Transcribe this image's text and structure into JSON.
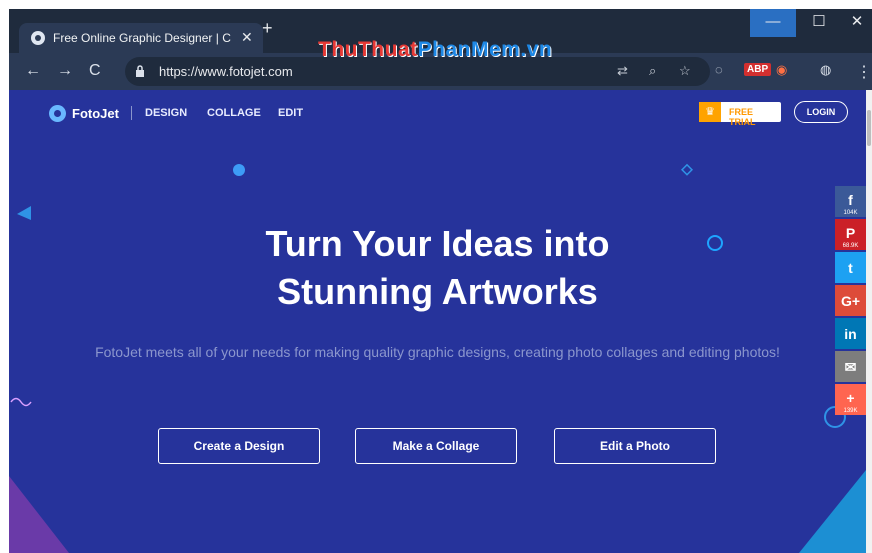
{
  "browser": {
    "tab_title": "Free Online Graphic Designer | C",
    "tab_close": "✕",
    "new_tab": "+",
    "window_controls": {
      "minimize": "—",
      "maximize": "☐",
      "close": "✕"
    },
    "url": "https://www.fotojet.com",
    "watermark": {
      "part1": "ThuThuat",
      "part2": "PhanMem.vn"
    },
    "extensions": {
      "abp": "ABP"
    }
  },
  "site": {
    "brand": "FotoJet",
    "nav": [
      "DESIGN",
      "COLLAGE",
      "EDIT"
    ],
    "free_trial": "FREE TRIAL",
    "login": "LOGIN"
  },
  "hero": {
    "title_line1": "Turn Your Ideas into",
    "title_line2": "Stunning Artworks",
    "subtitle": "FotoJet meets all of your needs for making quality graphic designs, creating photo collages and editing photos!",
    "buttons": [
      "Create a Design",
      "Make a Collage",
      "Edit a Photo"
    ]
  },
  "share": [
    {
      "name": "facebook",
      "glyph": "f",
      "count": "104K",
      "color": "#3b5998"
    },
    {
      "name": "pinterest",
      "glyph": "P",
      "count": "68.9K",
      "color": "#cb2027"
    },
    {
      "name": "twitter",
      "glyph": "t",
      "count": "",
      "color": "#1da1f2"
    },
    {
      "name": "google-plus",
      "glyph": "G+",
      "count": "",
      "color": "#dd4b39"
    },
    {
      "name": "linkedin",
      "glyph": "in",
      "count": "",
      "color": "#0077b5"
    },
    {
      "name": "email",
      "glyph": "✉",
      "count": "",
      "color": "#7d7d7d"
    },
    {
      "name": "more",
      "glyph": "+",
      "count": "139K",
      "color": "#ff6550"
    }
  ]
}
